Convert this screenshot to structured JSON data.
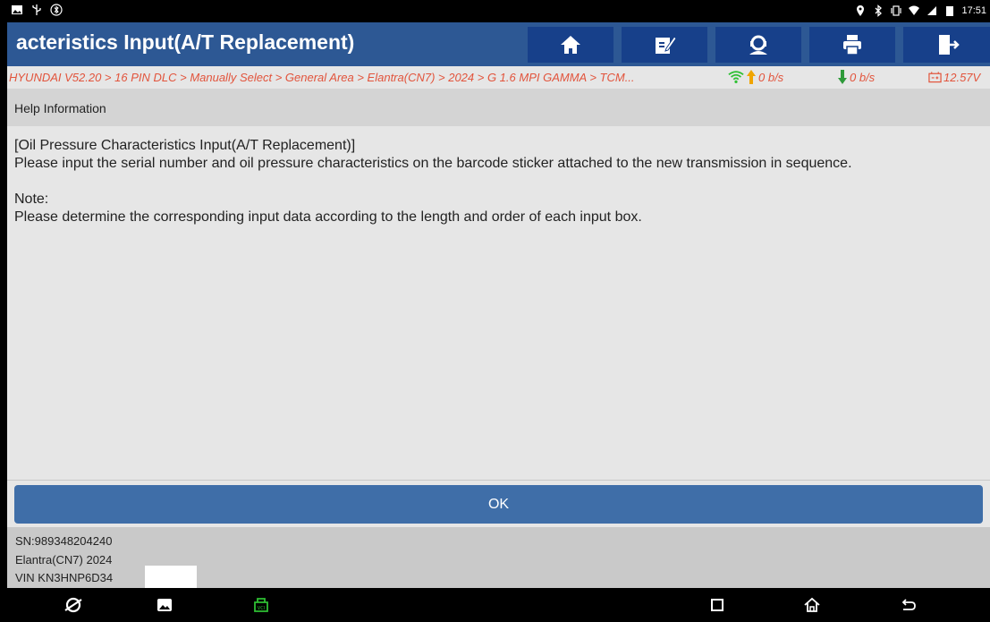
{
  "statusbar": {
    "time": "17:51",
    "left_icons": [
      "image-icon",
      "usb-icon",
      "bluetooth-icon"
    ],
    "right_icons": [
      "location-icon",
      "bluetooth-icon",
      "vibrate-icon",
      "wifi-icon",
      "signal-icon",
      "battery-icon"
    ]
  },
  "titlebar": {
    "title": "acteristics Input(A/T Replacement)",
    "buttons": [
      {
        "name": "home-button",
        "icon": "home-icon"
      },
      {
        "name": "edit-button",
        "icon": "edit-icon"
      },
      {
        "name": "support-button",
        "icon": "support-icon"
      },
      {
        "name": "print-button",
        "icon": "printer-icon"
      },
      {
        "name": "exit-button",
        "icon": "exit-icon"
      }
    ],
    "colors": {
      "bar": "#2d5894",
      "button": "#17408a"
    }
  },
  "breadcrumb": {
    "path": "HYUNDAI V52.20 > 16 PIN DLC > Manually Select > General Area > Elantra(CN7) > 2024 > G 1.6 MPI GAMMA > TCM...",
    "upload": "0 b/s",
    "download": "0 b/s",
    "voltage": "12.57V",
    "color": "#e2543c"
  },
  "help": {
    "header": "Help Information",
    "heading": "[Oil Pressure Characteristics Input(A/T Replacement)]",
    "body": "Please input the serial number and oil pressure characteristics on the barcode sticker attached to the new transmission in sequence.",
    "note_label": "Note:",
    "note_text": "Please determine the corresponding input data according to the length and order of each input box."
  },
  "actions": {
    "ok_label": "OK"
  },
  "footer": {
    "sn": "SN:989348204240",
    "vehicle": "Elantra(CN7) 2024",
    "vin": "VIN KN3HNP6D34"
  },
  "navbar": {
    "left_icons": [
      "browser-icon",
      "gallery-icon",
      "vci-icon"
    ],
    "right_icons": [
      "recents-icon",
      "home-nav-icon",
      "back-icon"
    ]
  }
}
